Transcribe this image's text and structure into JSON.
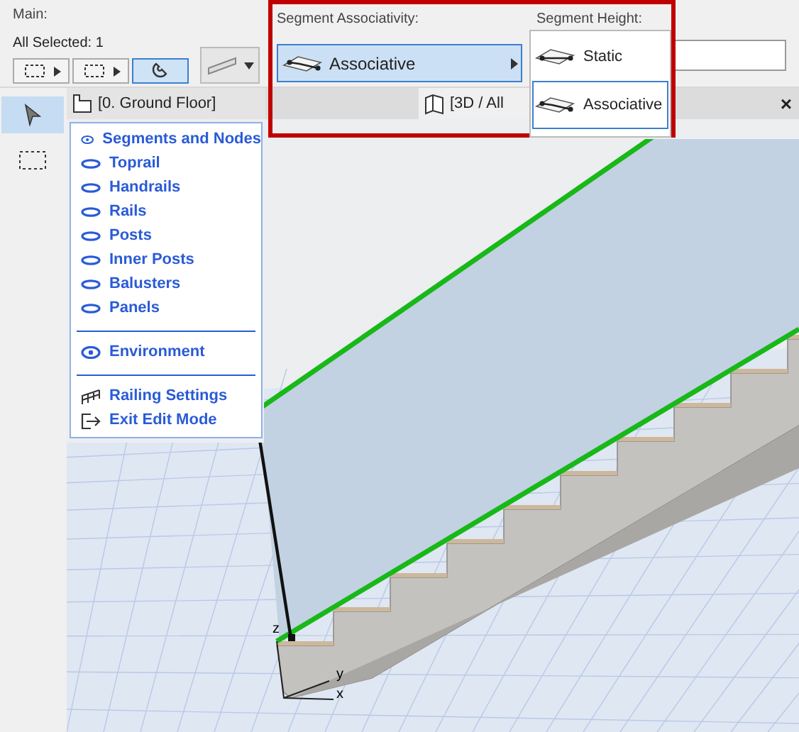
{
  "toolbar": {
    "title": "Main:",
    "selection": "All Selected: 1",
    "buttons": [
      {
        "selected": false
      },
      {
        "selected": false
      },
      {
        "selected": true
      }
    ]
  },
  "associativity": {
    "label": "Segment Associativity:",
    "value": "Associative",
    "height_label": "Segment Height:",
    "options": [
      {
        "label": "Static",
        "selected": false
      },
      {
        "label": "Associative",
        "selected": true
      }
    ]
  },
  "toolbox": [
    {
      "selected": true
    },
    {
      "selected": false
    }
  ],
  "tabs": [
    {
      "label": "[0. Ground Floor]",
      "selected": true
    },
    {
      "label": "[3D / All",
      "selected": false
    }
  ],
  "close": "×",
  "context_menu": {
    "sections": [
      [
        {
          "label": "Segments and Nodes",
          "kind": "eye",
          "visible": true
        },
        {
          "label": "Toprail",
          "kind": "eye",
          "visible": false
        },
        {
          "label": "Handrails",
          "kind": "eye",
          "visible": false
        },
        {
          "label": "Rails",
          "kind": "eye",
          "visible": false
        },
        {
          "label": "Posts",
          "kind": "eye",
          "visible": false
        },
        {
          "label": "Inner Posts",
          "kind": "eye",
          "visible": false
        },
        {
          "label": "Balusters",
          "kind": "eye",
          "visible": false
        },
        {
          "label": "Panels",
          "kind": "eye",
          "visible": false
        }
      ],
      [
        {
          "label": "Environment",
          "kind": "eye",
          "visible": true
        }
      ],
      [
        {
          "label": "Railing Settings",
          "kind": "settings"
        },
        {
          "label": "Exit Edit Mode",
          "kind": "exit"
        }
      ]
    ]
  },
  "axes": [
    "z",
    "y",
    "x"
  ]
}
